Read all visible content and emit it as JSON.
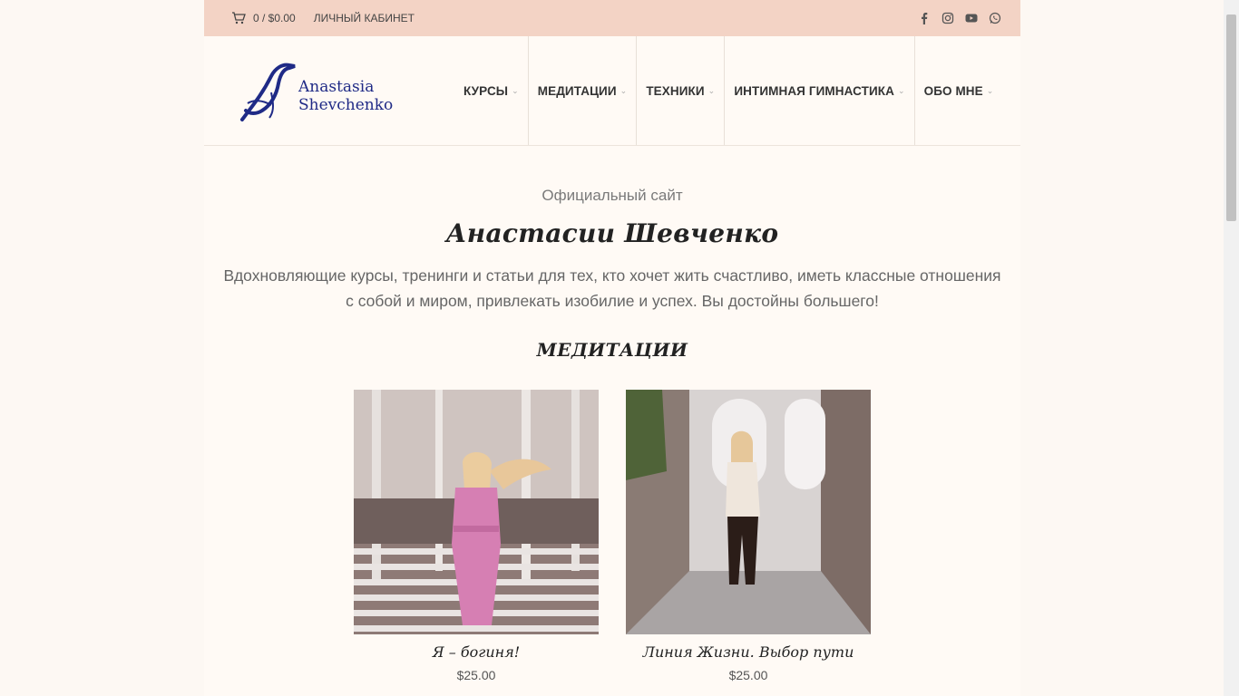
{
  "topbar": {
    "cart_text": "0 / $0.00",
    "account_label": "ЛИЧНЫЙ КАБИНЕТ",
    "social": [
      "facebook-icon",
      "instagram-icon",
      "youtube-icon",
      "whatsapp-icon"
    ]
  },
  "logo": {
    "line1": "Anastasia",
    "line2": "Shevchenko"
  },
  "nav": {
    "items": [
      {
        "label": "КУРСЫ"
      },
      {
        "label": "МЕДИТАЦИИ"
      },
      {
        "label": "ТЕХНИКИ"
      },
      {
        "label": "ИНТИМНАЯ ГИМНАСТИКА"
      },
      {
        "label": "ОБО МНЕ"
      }
    ]
  },
  "hero": {
    "subtitle": "Официальный сайт",
    "title": "Анастасии Шевченко",
    "desc_line1": "Вдохновляющие курсы, тренинги и статьи для тех, кто хочет жить счастливо, иметь классные отношения",
    "desc_line2": "с собой и миром, привлекать изобилие и успех. Вы достойны большего!"
  },
  "section": {
    "title": "МЕДИТАЦИИ"
  },
  "products": [
    {
      "name": "Я – богиня!",
      "price": "$25.00"
    },
    {
      "name": "Линия Жизни. Выбор пути",
      "price": "$25.00"
    }
  ],
  "colors": {
    "topbar": "#f3d3c5",
    "logo": "#1f2a86",
    "background": "#fffaf5"
  }
}
